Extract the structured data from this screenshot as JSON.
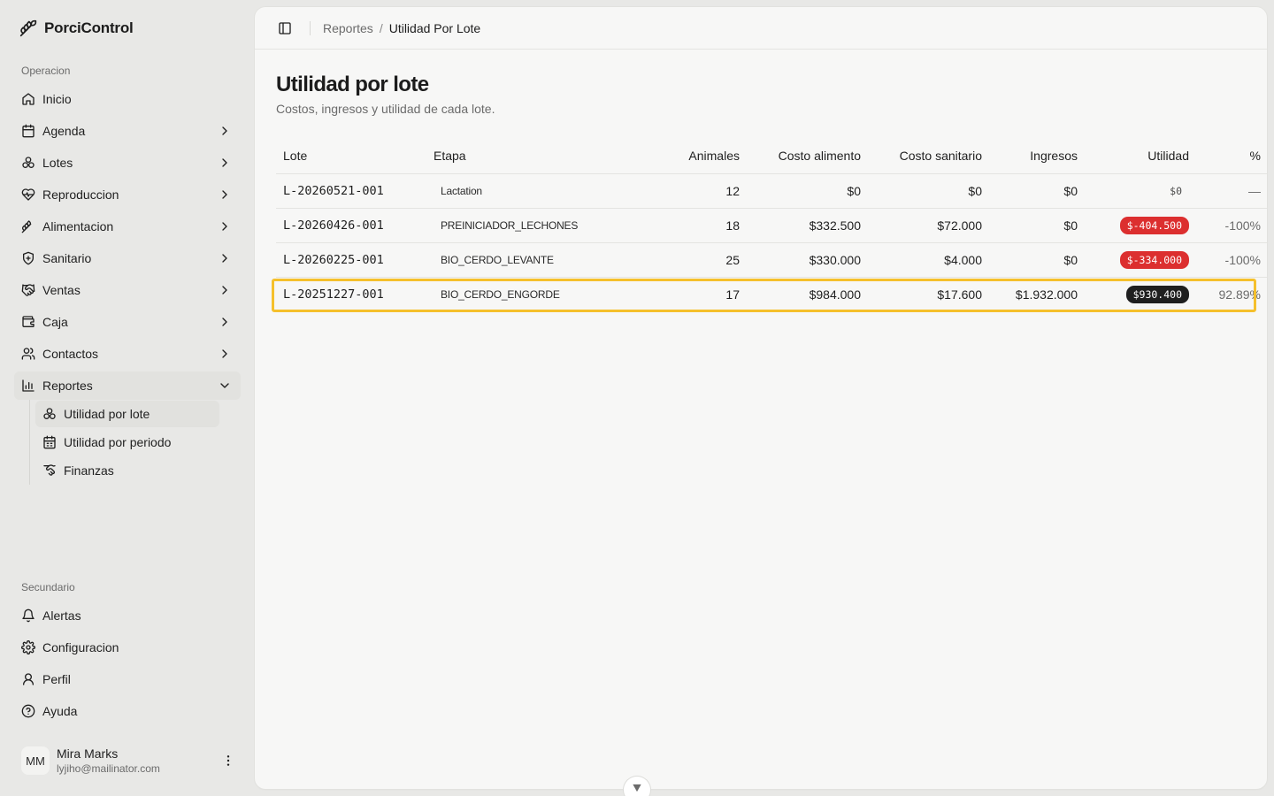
{
  "app": {
    "name": "PorciControl"
  },
  "sidebar": {
    "group_operacion": "Operacion",
    "items": [
      {
        "label": "Inicio"
      },
      {
        "label": "Agenda"
      },
      {
        "label": "Lotes"
      },
      {
        "label": "Reproduccion"
      },
      {
        "label": "Alimentacion"
      },
      {
        "label": "Sanitario"
      },
      {
        "label": "Ventas"
      },
      {
        "label": "Caja"
      },
      {
        "label": "Contactos"
      },
      {
        "label": "Reportes"
      }
    ],
    "reportes_sub": [
      {
        "label": "Utilidad por lote"
      },
      {
        "label": "Utilidad por periodo"
      },
      {
        "label": "Finanzas"
      }
    ],
    "group_secundario": "Secundario",
    "secondary": [
      {
        "label": "Alertas"
      },
      {
        "label": "Configuracion"
      },
      {
        "label": "Perfil"
      },
      {
        "label": "Ayuda"
      }
    ]
  },
  "user": {
    "initials": "MM",
    "name": "Mira Marks",
    "email": "lyjiho@mailinator.com"
  },
  "breadcrumb": {
    "parent": "Reportes",
    "separator": "/",
    "current": "Utilidad Por Lote"
  },
  "page": {
    "title": "Utilidad por lote",
    "subtitle": "Costos, ingresos y utilidad de cada lote."
  },
  "table": {
    "headers": [
      "Lote",
      "Etapa",
      "Animales",
      "Costo alimento",
      "Costo sanitario",
      "Ingresos",
      "Utilidad",
      "%"
    ],
    "rows": [
      {
        "lote": "L-20260521-001",
        "etapa": "Lactation",
        "animales": "12",
        "costo_alimento": "$0",
        "costo_sanitario": "$0",
        "ingresos": "$0",
        "utilidad": "$0",
        "pct": "—"
      },
      {
        "lote": "L-20260426-001",
        "etapa": "PREINICIADOR_LECHONES",
        "animales": "18",
        "costo_alimento": "$332.500",
        "costo_sanitario": "$72.000",
        "ingresos": "$0",
        "utilidad": "$-404.500",
        "pct": "-100%"
      },
      {
        "lote": "L-20260225-001",
        "etapa": "BIO_CERDO_LEVANTE",
        "animales": "25",
        "costo_alimento": "$330.000",
        "costo_sanitario": "$4.000",
        "ingresos": "$0",
        "utilidad": "$-334.000",
        "pct": "-100%"
      },
      {
        "lote": "L-20251227-001",
        "etapa": "BIO_CERDO_ENGORDE",
        "animales": "17",
        "costo_alimento": "$984.000",
        "costo_sanitario": "$17.600",
        "ingresos": "$1.932.000",
        "utilidad": "$930.400",
        "pct": "92.89%"
      }
    ]
  },
  "colors": {
    "negative_badge": "#dc2f2f",
    "positive_badge": "#1f1f1f",
    "highlight": "#f5c02c"
  }
}
